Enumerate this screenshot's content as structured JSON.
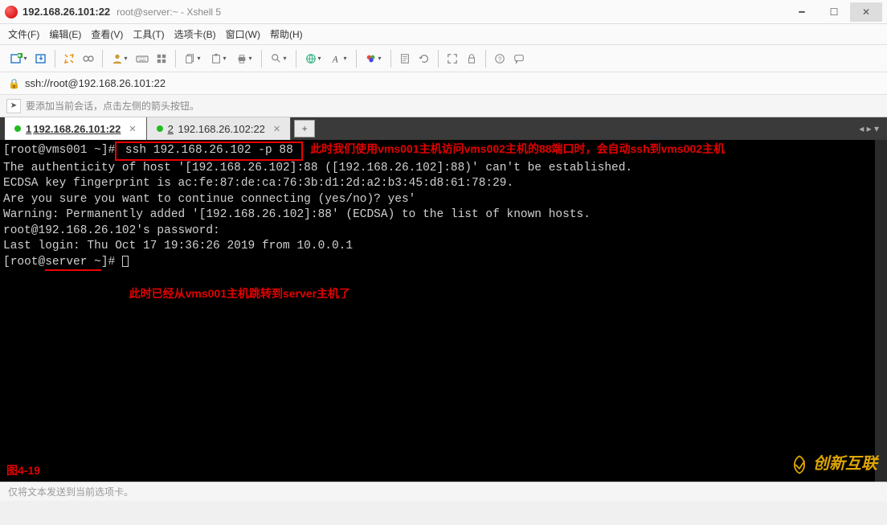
{
  "window": {
    "title_main": "192.168.26.101:22",
    "title_sub": "root@server:~ - Xshell 5"
  },
  "menu": {
    "file": "文件(F)",
    "edit": "编辑(E)",
    "view": "查看(V)",
    "tools": "工具(T)",
    "tabs": "选项卡(B)",
    "window": "窗口(W)",
    "help": "帮助(H)"
  },
  "addressbar": {
    "url": "ssh://root@192.168.26.101:22"
  },
  "infobar": {
    "text": "要添加当前会话，点击左侧的箭头按钮。"
  },
  "tabs": [
    {
      "num": "1",
      "label": "192.168.26.101:22",
      "active": true
    },
    {
      "num": "2",
      "label": "192.168.26.102:22",
      "active": false
    }
  ],
  "terminal": {
    "prompt1_user": "[root@vms001 ~]#",
    "command": " ssh 192.168.26.102 -p 88 ",
    "annotation1": "此时我们使用vms001主机访问vms002主机的88端口时，会自动ssh到vms002主机",
    "line2": "The authenticity of host '[192.168.26.102]:88 ([192.168.26.102]:88)' can't be established.",
    "line3": "ECDSA key fingerprint is ac:fe:87:de:ca:76:3b:d1:2d:a2:b3:45:d8:61:78:29.",
    "line4": "Are you sure you want to continue connecting (yes/no)? yes'",
    "line5": "Warning: Permanently added '[192.168.26.102]:88' (ECDSA) to the list of known hosts.",
    "line6": "root@192.168.26.102's password: ",
    "line7": "Last login: Thu Oct 17 19:36:26 2019 from 10.0.0.1",
    "prompt2_pre": "[root@",
    "prompt2_underlined": "server ~",
    "prompt2_post": "]# ",
    "annotation2": "此时已经从vms001主机跳转到server主机了",
    "figure_label": "图4-19",
    "watermark": "创新互联"
  },
  "statusbar": {
    "text": "仅将文本发送到当前选项卡。"
  }
}
